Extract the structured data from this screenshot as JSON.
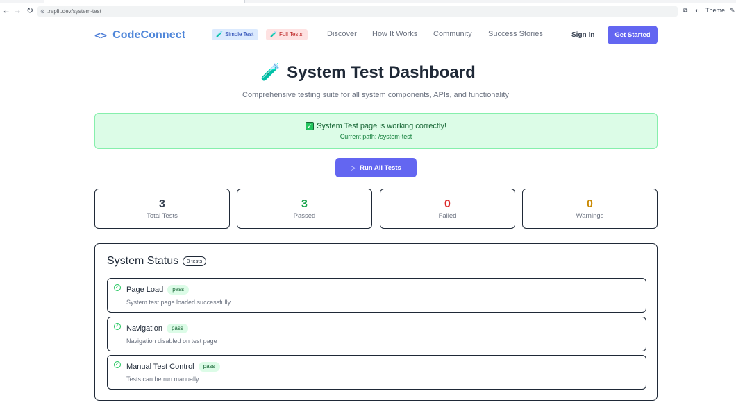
{
  "browser": {
    "url": ".replit.dev/system-test",
    "theme_label": "Theme"
  },
  "header": {
    "brand_name": "CodeConnect",
    "brand_icon": "<>",
    "simple_test_label": "Simple Test",
    "full_tests_label": "Full Tests",
    "nav": [
      "Discover",
      "How It Works",
      "Community",
      "Success Stories"
    ],
    "sign_in_label": "Sign In",
    "get_started_label": "Get Started"
  },
  "page": {
    "title": "System Test Dashboard",
    "title_icon": "test-tube-icon",
    "subtitle": "Comprehensive testing suite for all system components, APIs, and functionality"
  },
  "banner": {
    "message": "System Test page is working correctly!",
    "path_text": "Current path: /system-test"
  },
  "run_button_label": "Run All Tests",
  "stats": [
    {
      "value": "3",
      "label": "Total Tests",
      "color": "#374151"
    },
    {
      "value": "3",
      "label": "Passed",
      "color": "#16a34a"
    },
    {
      "value": "0",
      "label": "Failed",
      "color": "#dc2626"
    },
    {
      "value": "0",
      "label": "Warnings",
      "color": "#ca8a04"
    }
  ],
  "status": {
    "heading": "System Status",
    "count_label": "3 tests",
    "tests": [
      {
        "name": "Page Load",
        "badge": "pass",
        "description": "System test page loaded successfully"
      },
      {
        "name": "Navigation",
        "badge": "pass",
        "description": "Navigation disabled on test page"
      },
      {
        "name": "Manual Test Control",
        "badge": "pass",
        "description": "Tests can be run manually"
      }
    ]
  },
  "colors": {
    "accent": "#6366f1",
    "brand": "#4f86d9",
    "success_bg": "#dcfce7"
  }
}
